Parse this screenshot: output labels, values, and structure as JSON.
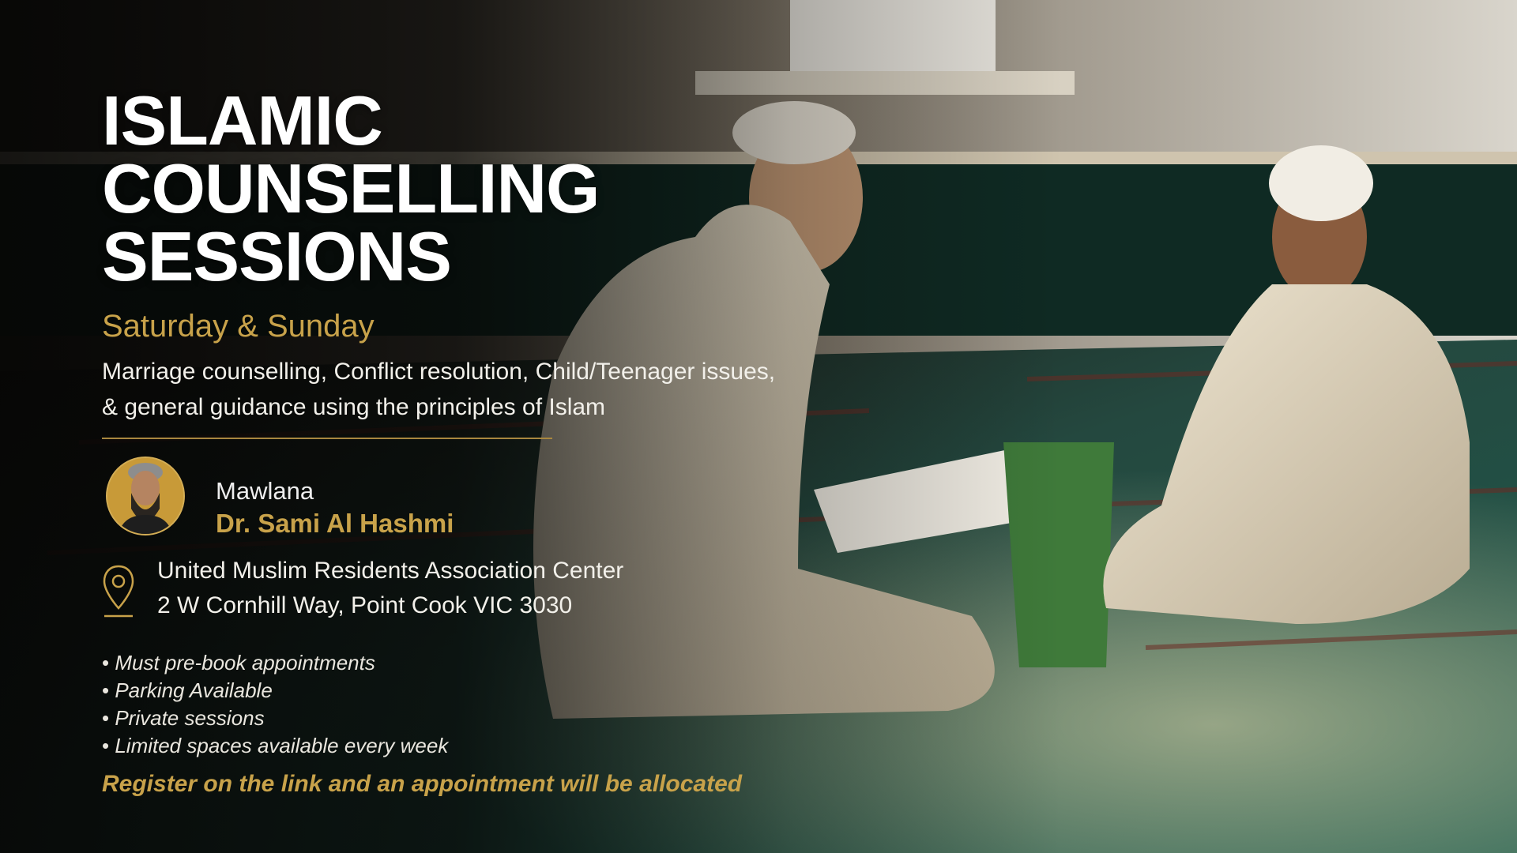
{
  "poster": {
    "title_lines": [
      "ISLAMIC",
      "COUNSELLING",
      "SESSIONS"
    ],
    "days": "Saturday & Sunday",
    "description": "Marriage counselling, Conflict resolution, Child/Teenager issues, & general guidance using the principles of Islam",
    "host": {
      "role": "Mawlana",
      "name": "Dr. Sami Al Hashmi"
    },
    "location": {
      "line1": "United Muslim Residents Association Center",
      "line2": "2 W Cornhill Way, Point Cook VIC 3030"
    },
    "bullets": [
      "Must pre-book appointments",
      "Parking Available",
      "Private sessions",
      "Limited spaces available every week"
    ],
    "cta": "Register on the link and an appointment will be allocated",
    "colors": {
      "accent": "#c8a24a",
      "text": "#ffffff",
      "carpet": "#1e5a4c"
    },
    "icons": {
      "location": "location-pin-icon"
    }
  }
}
